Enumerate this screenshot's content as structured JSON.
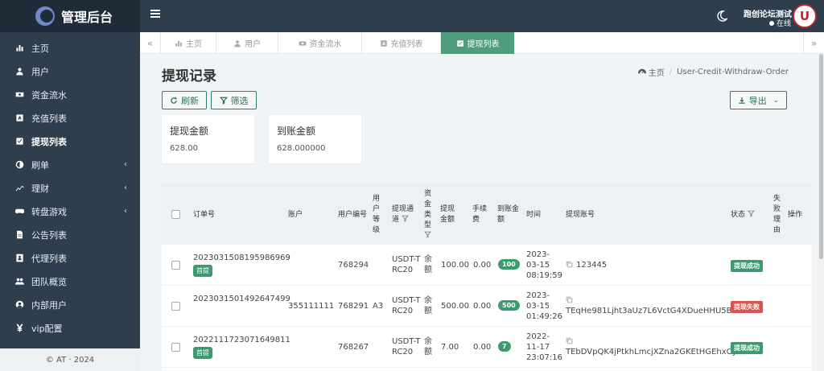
{
  "app": {
    "title": "管理后台"
  },
  "sidebar": {
    "items": [
      {
        "label": "主页",
        "icon": "bar-chart-icon"
      },
      {
        "label": "用户",
        "icon": "user-icon"
      },
      {
        "label": "资金流水",
        "icon": "money-icon"
      },
      {
        "label": "充值列表",
        "icon": "list-icon"
      },
      {
        "label": "提现列表",
        "icon": "check-square-icon",
        "active": true
      },
      {
        "label": "刷单",
        "icon": "half-circle-icon",
        "arrow": "‹"
      },
      {
        "label": "理财",
        "icon": "chart-icon",
        "arrow": "‹"
      },
      {
        "label": "转盘游戏",
        "icon": "gamepad-icon",
        "arrow": "‹"
      },
      {
        "label": "公告列表",
        "icon": "file-icon"
      },
      {
        "label": "代理列表",
        "icon": "id-card-icon"
      },
      {
        "label": "团队概览",
        "icon": "users-icon"
      },
      {
        "label": "内部用户",
        "icon": "user-circle-icon"
      },
      {
        "label": "vip配置",
        "icon": "yen-icon"
      }
    ],
    "copyright": "© AT · 2024"
  },
  "topbar": {
    "user_name": "跑创论坛测试",
    "user_status": "在线",
    "avatar_text": "U"
  },
  "tabs": [
    {
      "label": "主页",
      "icon": "bar-chart-icon"
    },
    {
      "label": "用户",
      "icon": "user-icon"
    },
    {
      "label": "资金流水",
      "icon": "money-icon"
    },
    {
      "label": "充值列表",
      "icon": "list-icon"
    },
    {
      "label": "提现列表",
      "icon": "check-square-icon",
      "active": true
    }
  ],
  "page": {
    "title": "提现记录",
    "breadcrumb": {
      "home": "主页",
      "current": "User-Credit-Withdraw-Order"
    },
    "refresh_label": "刷新",
    "filter_label": "筛选",
    "export_label": "导出"
  },
  "stats": [
    {
      "label": "提现金额",
      "value": "628.00"
    },
    {
      "label": "到账金额",
      "value": "628.000000"
    }
  ],
  "table": {
    "headers": {
      "order_no": "订单号",
      "account": "账户",
      "user_id": "用户编号",
      "user_level": "用户等级",
      "channel": "提现通道",
      "fund_type": "资金类型",
      "amount": "提现金额",
      "fee": "手续费",
      "received": "到账金额",
      "time": "时间",
      "withdraw_account": "提现账号",
      "status": "状态",
      "fail_reason": "失败理由",
      "actions": "操作"
    },
    "rows": [
      {
        "order_no": "2023031508195986969",
        "first_tag": "首提",
        "account": "",
        "user_id": "768294",
        "level": "",
        "channel": "USDT-TRC20",
        "fund_type": "余额",
        "amount": "100.00",
        "fee": "0.00",
        "received": "100",
        "time": "2023-03-15 08:19:59",
        "withdraw_account": "123445",
        "status": "提现成功",
        "status_type": "ok"
      },
      {
        "order_no": "2023031501492647499",
        "first_tag": "",
        "account": "355111111",
        "user_id": "768291",
        "level": "A3",
        "channel": "USDT-TRC20",
        "fund_type": "余额",
        "amount": "500.00",
        "fee": "0.00",
        "received": "500",
        "time": "2023-03-15 01:49:26",
        "withdraw_account": "TEqHe981Ljht3aUz7L6VctG4XDueHHU5Bh",
        "status": "提现失败",
        "status_type": "fail"
      },
      {
        "order_no": "2022111723071649811",
        "first_tag": "首提",
        "account": "",
        "user_id": "768267",
        "level": "",
        "channel": "USDT-TRC20",
        "fund_type": "余额",
        "amount": "7.00",
        "fee": "0.00",
        "received": "7",
        "time": "2022-11-17 23:07:16",
        "withdraw_account": "TEbDVpQK4jPtkhLmcjXZna2GKEtHGEhxCy",
        "status": "提现成功",
        "status_type": "ok"
      }
    ]
  },
  "colors": {
    "sidebar_bg": "#2f3e4d",
    "accent": "#4f9d7c",
    "success": "#3b9a6e",
    "danger": "#d9534f"
  }
}
